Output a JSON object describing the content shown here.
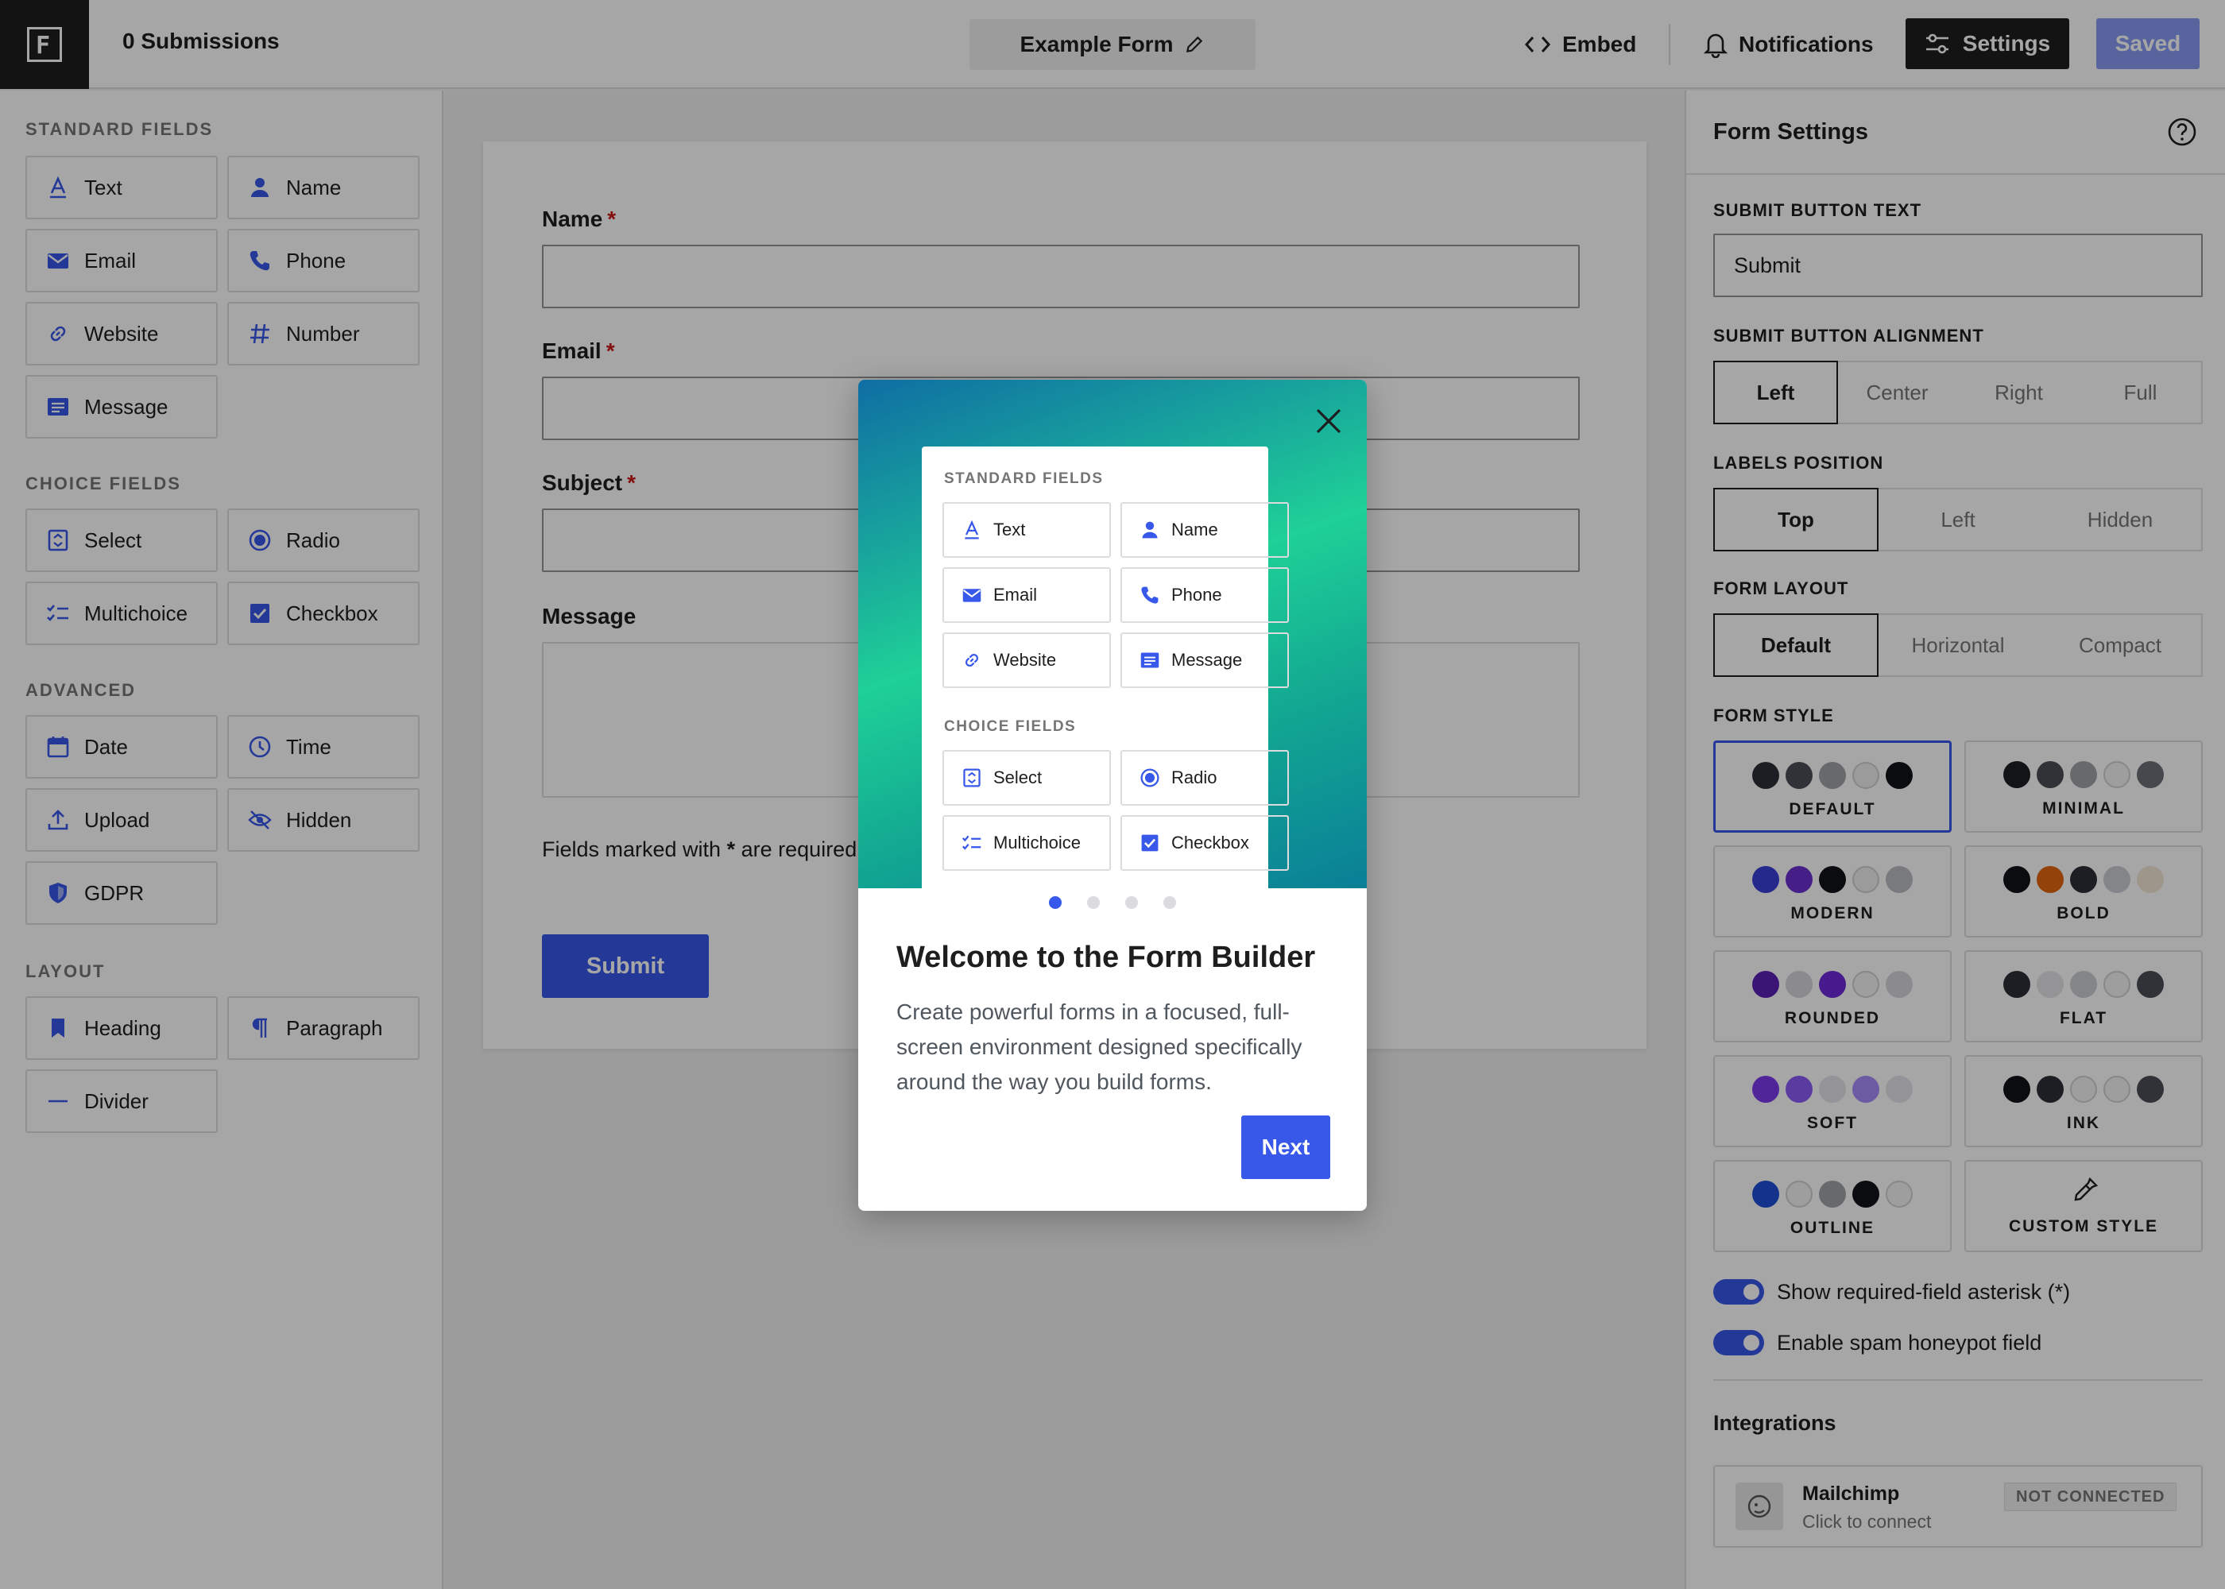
{
  "topbar": {
    "logo_letter": "F",
    "submissions": "0 Submissions",
    "form_title": "Example Form",
    "embed": "Embed",
    "notifications": "Notifications",
    "settings": "Settings",
    "saved": "Saved"
  },
  "sidebar": {
    "standard_title": "STANDARD FIELDS",
    "standard": [
      {
        "label": "Text",
        "icon": "text-icon"
      },
      {
        "label": "Name",
        "icon": "person-icon"
      },
      {
        "label": "Email",
        "icon": "envelope-icon"
      },
      {
        "label": "Phone",
        "icon": "phone-icon"
      },
      {
        "label": "Website",
        "icon": "link-icon"
      },
      {
        "label": "Number",
        "icon": "hash-icon"
      },
      {
        "label": "Message",
        "icon": "message-icon"
      }
    ],
    "choice_title": "CHOICE FIELDS",
    "choice": [
      {
        "label": "Select",
        "icon": "select-icon"
      },
      {
        "label": "Radio",
        "icon": "radio-icon"
      },
      {
        "label": "Multichoice",
        "icon": "checklist-icon"
      },
      {
        "label": "Checkbox",
        "icon": "checkbox-icon"
      }
    ],
    "advanced_title": "ADVANCED",
    "advanced": [
      {
        "label": "Date",
        "icon": "calendar-icon"
      },
      {
        "label": "Time",
        "icon": "clock-icon"
      },
      {
        "label": "Upload",
        "icon": "upload-icon"
      },
      {
        "label": "Hidden",
        "icon": "eye-slash-icon"
      },
      {
        "label": "GDPR",
        "icon": "shield-icon"
      }
    ],
    "layout_title": "LAYOUT",
    "layout": [
      {
        "label": "Heading",
        "icon": "bookmark-icon"
      },
      {
        "label": "Paragraph",
        "icon": "pilcrow-icon"
      },
      {
        "label": "Divider",
        "icon": "divider-icon"
      }
    ]
  },
  "form": {
    "name_label": "Name",
    "email_label": "Email",
    "subject_label": "Subject",
    "message_label": "Message",
    "required_mark": "*",
    "note_before": "Fields marked with",
    "note_mark": "*",
    "note_after": "are required",
    "submit": "Submit"
  },
  "settings": {
    "title": "Form Settings",
    "submit_text_label": "SUBMIT BUTTON TEXT",
    "submit_text_value": "Submit",
    "alignment_label": "SUBMIT BUTTON ALIGNMENT",
    "alignment": [
      "Left",
      "Center",
      "Right",
      "Full"
    ],
    "alignment_selected": "Left",
    "labels_label": "LABELS POSITION",
    "labels": [
      "Top",
      "Left",
      "Hidden"
    ],
    "labels_selected": "Top",
    "layout_label": "FORM LAYOUT",
    "layout": [
      "Default",
      "Horizontal",
      "Compact"
    ],
    "layout_selected": "Default",
    "style_label": "FORM STYLE",
    "styles": [
      {
        "name": "DEFAULT",
        "colors": [
          "#2c2f36",
          "#4a4e56",
          "#9ea2a8",
          "#eeeeee",
          "#111318"
        ],
        "selected": true
      },
      {
        "name": "MINIMAL",
        "colors": [
          "#1e2025",
          "#4a4e56",
          "#9ea2a8",
          "#f3f3f3",
          "#6b6f76"
        ],
        "selected": false
      },
      {
        "name": "MODERN",
        "colors": [
          "#3a3fd6",
          "#6a2fd0",
          "#111318",
          "#eeeeee",
          "#b9bcc2"
        ],
        "selected": false
      },
      {
        "name": "BOLD",
        "colors": [
          "#111318",
          "#e2660f",
          "#2c2f36",
          "#c9ccd1",
          "#f5e6d6"
        ],
        "selected": false
      },
      {
        "name": "ROUNDED",
        "colors": [
          "#5b21b6",
          "#d4d4dc",
          "#6d28d9",
          "#f3f3f3",
          "#d4d4dc"
        ],
        "selected": false
      },
      {
        "name": "FLAT",
        "colors": [
          "#2c2f36",
          "#e4e4e7",
          "#c9ccd1",
          "#f3f3f3",
          "#4a4e56"
        ],
        "selected": false
      },
      {
        "name": "SOFT",
        "colors": [
          "#7c3aed",
          "#8b5cf6",
          "#e4e4ea",
          "#a78bfa",
          "#e4e4ea"
        ],
        "selected": false
      },
      {
        "name": "INK",
        "colors": [
          "#111318",
          "#2c2f36",
          "#f3f3f3",
          "#f3f3f3",
          "#4a4e56"
        ],
        "selected": false
      },
      {
        "name": "OUTLINE",
        "colors": [
          "#1d4ed8",
          "#f3f3f3",
          "#9ea2a8",
          "#111318",
          "#f3f3f3"
        ],
        "selected": false
      }
    ],
    "custom_style": "CUSTOM STYLE",
    "asterisk_toggle": "Show required-field asterisk (*)",
    "honeypot_toggle": "Enable spam honeypot field",
    "integrations_title": "Integrations",
    "integration_name": "Mailchimp",
    "integration_sub": "Click to connect",
    "integration_status": "NOT CONNECTED"
  },
  "modal": {
    "mock_standard_title": "STANDARD FIELDS",
    "mock_standard": [
      "Text",
      "Name",
      "Email",
      "Phone",
      "Website",
      "Message"
    ],
    "mock_choice_title": "CHOICE FIELDS",
    "mock_choice": [
      "Select",
      "Radio",
      "Multichoice",
      "Checkbox"
    ],
    "pages": 4,
    "current_page": 1,
    "heading": "Welcome to the Form Builder",
    "body": "Create powerful forms in a focused, full-screen environment designed specifically around the way you build forms.",
    "next": "Next"
  },
  "colors": {
    "accent": "#3858e9",
    "dark": "#1e1e1e",
    "required": "#cc1818"
  }
}
